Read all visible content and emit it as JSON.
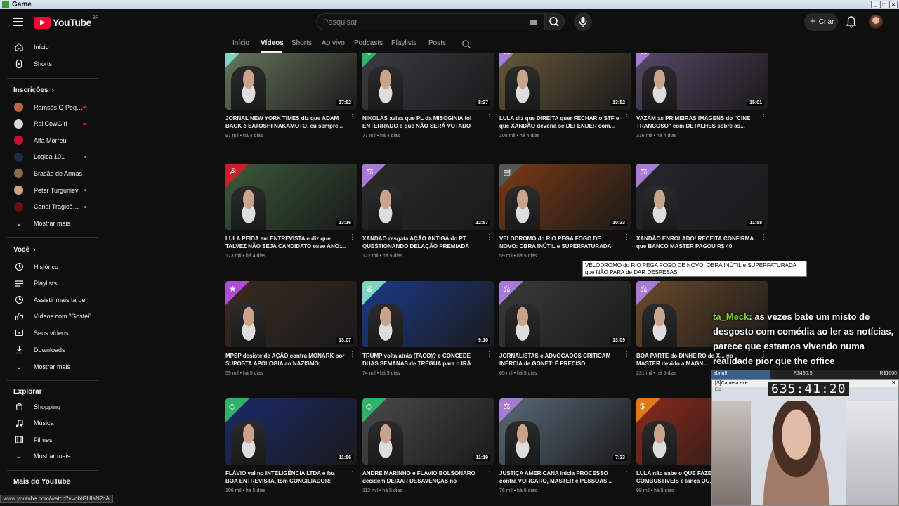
{
  "window": {
    "title": "Game"
  },
  "header": {
    "logo_text": "YouTube",
    "logo_region": "BR",
    "search_placeholder": "Pesquisar",
    "create_label": "Criar"
  },
  "sidebar": {
    "main": [
      {
        "label": "Início",
        "icon": "home-icon"
      },
      {
        "label": "Shorts",
        "icon": "shorts-icon"
      }
    ],
    "subscriptions_heading": "Inscrições",
    "subscriptions": [
      {
        "label": "Ramsés O Pequeno",
        "live": true,
        "color": "#b5653f"
      },
      {
        "label": "RailCowGirl",
        "live": true,
        "color": "#d8d8d8"
      },
      {
        "label": "Alfa Morreu",
        "live": false,
        "color": "#c8102e"
      },
      {
        "label": "Logica 101",
        "new": true,
        "color": "#1e2a4a"
      },
      {
        "label": "Brasão de Armas",
        "new": false,
        "color": "#8a6a4a"
      },
      {
        "label": "Peter Turguniev",
        "new": true,
        "color": "#caa48a"
      },
      {
        "label": "Canal Tragicômico",
        "new": true,
        "color": "#6a1010"
      }
    ],
    "show_more": "Mostrar mais",
    "you_heading": "Você",
    "you": [
      {
        "label": "Histórico",
        "icon": "history-icon"
      },
      {
        "label": "Playlists",
        "icon": "playlists-icon"
      },
      {
        "label": "Assistir mais tarde",
        "icon": "watch-later-icon"
      },
      {
        "label": "Vídeos com \"Gostei\"",
        "icon": "like-icon"
      },
      {
        "label": "Seus vídeos",
        "icon": "your-videos-icon"
      },
      {
        "label": "Downloads",
        "icon": "download-icon"
      }
    ],
    "explore_heading": "Explorar",
    "explore": [
      {
        "label": "Shopping",
        "icon": "shopping-icon"
      },
      {
        "label": "Música",
        "icon": "music-icon"
      },
      {
        "label": "Filmes",
        "icon": "movies-icon"
      }
    ],
    "more_heading": "Mais do YouTube"
  },
  "tabs": [
    "Início",
    "Vídeos",
    "Shorts",
    "Ao vivo",
    "Podcasts",
    "Playlists",
    "Posts"
  ],
  "active_tab": "Vídeos",
  "videos": [
    {
      "title": "JORNAL NEW YORK TIMES diz que ADAM BACK é SATOSHI NAKAMOTO, eu sempre...",
      "views": "97 mil",
      "age": "há 4 dias",
      "duration": "17:52",
      "tag": "world",
      "bg": "#6a7a60"
    },
    {
      "title": "NIKOLAS avisa que PL da MISOGINIA foi ENTERRADO e que NÃO SERÁ VOTADO ESS...",
      "views": "77 mil",
      "age": "há 4 dias",
      "duration": "8:37",
      "tag": "brazil",
      "bg": "#3a3f44"
    },
    {
      "title": "LULA diz que DIREITA quer FECHAR o STF e que XANDÃO deveria se DEFENDER com...",
      "views": "108 mil",
      "age": "há 4 dias",
      "duration": "13:52",
      "tag": "law",
      "bg": "#6b5a3a"
    },
    {
      "title": "VAZAM as PRIMEIRAS IMAGENS do \"CINE TRANCOSO\" com DETALHES sobre as...",
      "views": "316 mil",
      "age": "há 4 dias",
      "duration": "15:01",
      "tag": "law",
      "bg": "#5a4a6a"
    },
    {
      "title": "LULA PEIDA em ENTREVISTA e diz que TALVEZ NÃO SEJA CANDIDATO esse ANO:...",
      "views": "173 mil",
      "age": "há 4 dias",
      "duration": "13:16",
      "tag": "communist",
      "bg": "#3a5a3a"
    },
    {
      "title": "XANDAO resgata AÇÃO ANTIGA do PT QUESTIONANDO DELAÇÃO PREMIADA para...",
      "views": "122 mil",
      "age": "há 5 dias",
      "duration": "12:57",
      "tag": "law",
      "bg": "#2a2a2a"
    },
    {
      "title": "VELODROMO do RIO PEGA FOGO DE NOVO: OBRA INÚTIL e SUPERFATURADA que NÃO...",
      "views": "59 mil",
      "age": "há 5 dias",
      "duration": "10:33",
      "tag": "news",
      "bg": "#7a3a14"
    },
    {
      "title": "XANDÃO ENROLADO! RECEITA CONFIRMA que BANCO MASTER PAGOU R$ 40 MILHÕE...",
      "views": "",
      "age": "",
      "duration": "11:58",
      "tag": "law",
      "bg": "#24262c"
    },
    {
      "title": "MPSP desiste de AÇÃO contra MONARK por SUPOSTA APOLOGIA ao NAZISMO: CERTO,...",
      "views": "59 mil",
      "age": "há 5 dias",
      "duration": "13:07",
      "tag": "star",
      "bg": "#3a2a22"
    },
    {
      "title": "TRUMP volta atrás (TACO)? e CONCEDE DUAS SEMANAS de TRÉGUA para o IRÃ par...",
      "views": "74 mil",
      "age": "há 5 dias",
      "duration": "9:10",
      "tag": "world",
      "bg": "#1a3a8a"
    },
    {
      "title": "JORNALISTAS e ADVOGADOS CRITICAM INÉRCIA de GONET: É PRECISO INVESTIGA...",
      "views": "65 mil",
      "age": "há 5 dias",
      "duration": "13:09",
      "tag": "law",
      "bg": "#3a3a3a"
    },
    {
      "title": "BOA PARTE do DINHEIRO do X... no MASTER devido a MAGN...",
      "views": "231 mil",
      "age": "há 5 dias",
      "duration": "",
      "tag": "law",
      "bg": "#6a4a2a"
    },
    {
      "title": "FLÁVIO vai no INTELIGÊNCIA LTDA e faz BOA ENTREVISTA, tom CONCILIADOR: CARA...",
      "views": "106 mil",
      "age": "há 5 dias",
      "duration": "11:56",
      "tag": "brazil",
      "bg": "#1a2a6a"
    },
    {
      "title": "ANDRE MARINHO e FLAVIO BOLSONARO decidem DEIXAR DESAVENÇAS no PASSAD...",
      "views": "112 mil",
      "age": "há 5 dias",
      "duration": "11:19",
      "tag": "brazil",
      "bg": "#4a4a4a"
    },
    {
      "title": "JUSTIÇA AMERICANA inicia PROCESSO contra VORCARO, MASTER e PESSOAS...",
      "views": "76 mil",
      "age": "há 6 dias",
      "duration": "7:33",
      "tag": "law",
      "bg": "#5a6a7a"
    },
    {
      "title": "LULA não sabe o QUE FAZE... COMBUSTIVEIS e lança OU...",
      "views": "98 mil",
      "age": "há 5 dias",
      "duration": "",
      "tag": "money",
      "bg": "#8a2a1a"
    }
  ],
  "tooltip": "VELODROMO do RIO PEGA FOGO DE NOVO: OBRA INÚTIL e SUPERFATURADA que NÃO PARA de DAR DESPESAS",
  "stream": {
    "chat_user": "ta_Meck",
    "chat_message": ": as vezes bate um misto de desgosto com comédia ao ler as notícias, parece que estamos vivendo numa realidade pior que the office",
    "goal_left": "abriu!!!",
    "goal_mid": "R$490.5",
    "goal_right": "R$1600",
    "goal_progress": 0.31,
    "cam_title": "[S]Camera.exe",
    "cam_sub": "Elo",
    "timer": "635:41:20"
  },
  "status_url": "www.youtube.com/watch?v=obIGUIaN2oA"
}
